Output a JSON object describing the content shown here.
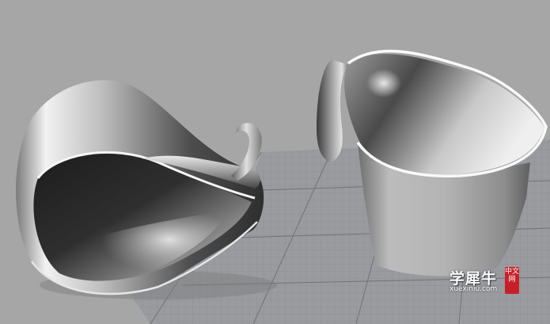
{
  "viewport": {
    "background": "#a6a6a6",
    "grid_color": "#7f8287",
    "grid_background": "#999b9f"
  },
  "scene": {
    "objects": [
      "cup-left-tilted",
      "cup-right-upright"
    ]
  },
  "watermark": {
    "main": "学犀牛",
    "sub": "xuexiniu.com",
    "seal": "中文网",
    "seal_color": "#c8202a"
  }
}
